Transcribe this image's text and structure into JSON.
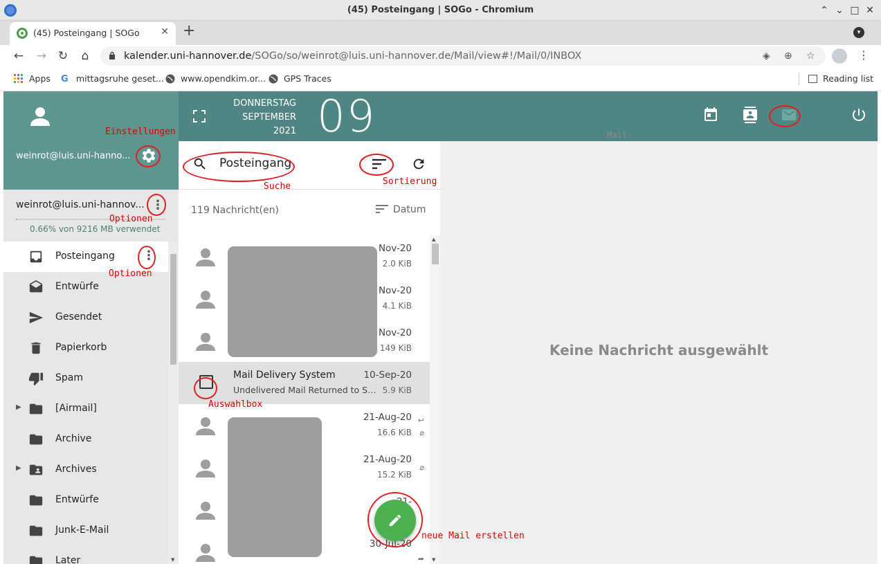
{
  "window": {
    "title": "(45) Posteingang | SOGo - Chromium",
    "controls": [
      "⌃",
      "⌄",
      "□",
      "✕"
    ]
  },
  "tabs": [
    {
      "label": "(45) Posteingang | SOGo",
      "close": "✕"
    }
  ],
  "new_tab": "+",
  "address_bar": {
    "host": "kalender.uni-hannover.de",
    "path": "/SOGo/so/weinrot@luis.uni-hannover.de/Mail/view#!/Mail/0/INBOX"
  },
  "bookmarks": [
    {
      "label": "Apps",
      "icon": "apps-grid-icon"
    },
    {
      "label": "mittagsruhe geset...",
      "icon": "google-icon"
    },
    {
      "label": "www.opendkim.or...",
      "icon": "globe-icon"
    },
    {
      "label": "GPS Traces",
      "icon": "globe-icon"
    }
  ],
  "reading_list": "Reading list",
  "sidebar": {
    "user_email": "weinrot@luis.uni-hanno...",
    "account_name": "weinrot@luis.uni-hannov...",
    "quota_text": "0.66% von 9216 MB verwendet",
    "quota_fraction": 0.0066,
    "folders": [
      {
        "label": "Posteingang",
        "icon": "inbox-icon",
        "active": true,
        "more": "⋮"
      },
      {
        "label": "Entwürfe",
        "icon": "drafts-icon"
      },
      {
        "label": "Gesendet",
        "icon": "send-icon"
      },
      {
        "label": "Papierkorb",
        "icon": "trash-icon"
      },
      {
        "label": "Spam",
        "icon": "thumb-down-icon"
      },
      {
        "label": "[Airmail]",
        "icon": "folder-icon",
        "expandable": true
      },
      {
        "label": "Archive",
        "icon": "folder-icon"
      },
      {
        "label": "Archives",
        "icon": "shared-folder-icon",
        "expandable": true
      },
      {
        "label": "Entwürfe",
        "icon": "folder-icon"
      },
      {
        "label": "Junk-E-Mail",
        "icon": "folder-icon"
      },
      {
        "label": "Later",
        "icon": "folder-icon"
      }
    ]
  },
  "topbar": {
    "weekday": "DONNERSTAG",
    "month": "SEPTEMBER",
    "year": "2021",
    "day": "09",
    "mail_caption": "Mail"
  },
  "message_list": {
    "mailbox_title": "Posteingang",
    "count": "119 Nachricht(en)",
    "sort_label": "Datum",
    "messages": [
      {
        "from": "",
        "subject": "",
        "date": "Nov-20",
        "size": "2.0 KiB"
      },
      {
        "from": "",
        "subject": "",
        "date": "Nov-20",
        "size": "4.1 KiB"
      },
      {
        "from": "",
        "subject": "...",
        "date": "Nov-20",
        "size": "149 KiB"
      },
      {
        "from": "Mail Delivery System",
        "subject": "Undelivered Mail Returned to Se...",
        "date": "10-Sep-20",
        "size": "5.9 KiB",
        "selected": true
      },
      {
        "from": "",
        "subject": "",
        "date": "21-Aug-20",
        "size": "16.6 KiB",
        "flags": [
          "reply-icon",
          "attachment-icon"
        ]
      },
      {
        "from": "",
        "subject": "",
        "date": "21-Aug-20",
        "size": "15.2 KiB",
        "flags": [
          "attachment-icon"
        ]
      },
      {
        "from": "",
        "subject": "",
        "date": "21-",
        "size": "",
        "flags": []
      },
      {
        "from": "",
        "subject": "",
        "date": "30-Jul-20",
        "size": "",
        "flags": [
          "forward-icon"
        ]
      }
    ]
  },
  "detail": {
    "empty_text": "Keine Nachricht ausgewählt"
  },
  "annotations": {
    "settings": "Einstellungen",
    "search": "Suche",
    "sort": "Sortierung",
    "options_account": "Optionen",
    "options_folder": "Optionen",
    "checkbox": "Auswahlbox",
    "compose": "neue Mail erstellen"
  },
  "colors": {
    "sidebar_header": "#5f9590",
    "topbar": "#4f8582",
    "fab": "#4caf50",
    "annotation": "#e00000"
  }
}
